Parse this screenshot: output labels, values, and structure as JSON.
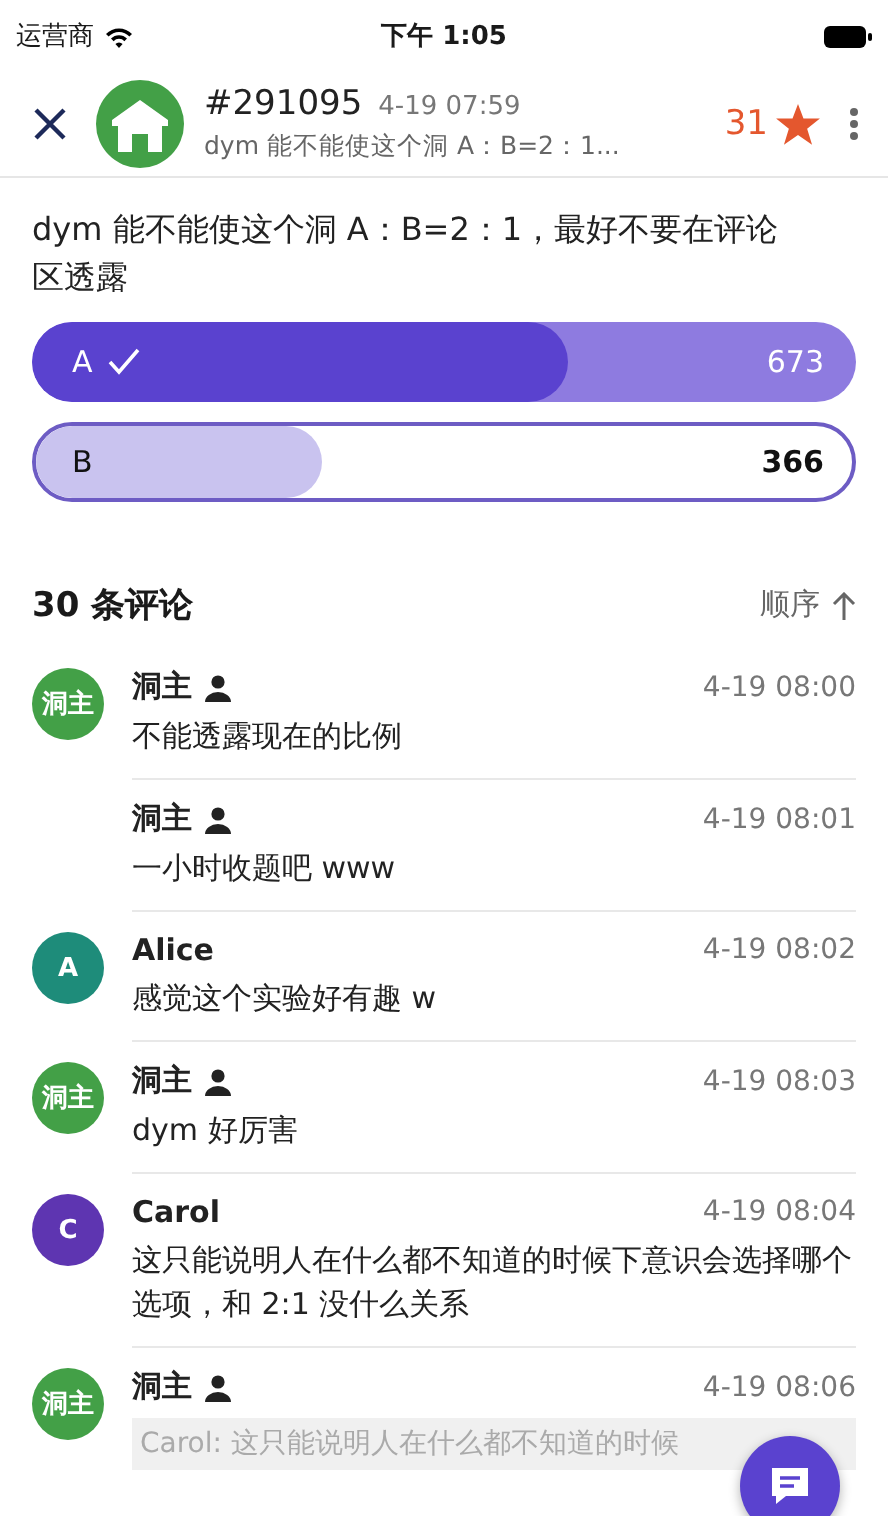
{
  "status_bar": {
    "carrier": "运营商",
    "time": "下午 1:05"
  },
  "header": {
    "title": "#291095",
    "time": "4-19 07:59",
    "subtitle": "dym 能不能使这个洞 A：B=2：1...",
    "stars": "31"
  },
  "post": {
    "text": "dym 能不能使这个洞 A：B=2：1，最好不要在评论区透露"
  },
  "poll": [
    {
      "label": "A",
      "count": "673",
      "level": 0.65,
      "selected": true
    },
    {
      "label": "B",
      "count": "366",
      "level": 0.35,
      "selected": false
    }
  ],
  "comments_header": {
    "count": "30 条评论",
    "sort": "顺序"
  },
  "comments": [
    {
      "avatar": {
        "label": "洞主",
        "color": "#43a047"
      },
      "name": "洞主",
      "is_owner": true,
      "time": "4-19 08:00",
      "text": "不能透露现在的比例"
    },
    {
      "name": "洞主",
      "is_owner": true,
      "time": "4-19 08:01",
      "text": "一小时收题吧 www"
    },
    {
      "avatar": {
        "label": "A",
        "color": "#1e8c7a"
      },
      "name": "Alice",
      "is_owner": false,
      "time": "4-19 08:02",
      "text": "感觉这个实验好有趣 w"
    },
    {
      "avatar": {
        "label": "洞主",
        "color": "#43a047"
      },
      "name": "洞主",
      "is_owner": true,
      "time": "4-19 08:03",
      "text": "dym 好厉害"
    },
    {
      "avatar": {
        "label": "C",
        "color": "#5e35b1"
      },
      "name": "Carol",
      "is_owner": false,
      "time": "4-19 08:04",
      "text": "这只能说明人在什么都不知道的时候下意识会选择哪个选项，和 2:1 没什么关系"
    },
    {
      "avatar": {
        "label": "洞主",
        "color": "#43a047"
      },
      "name": "洞主",
      "is_owner": true,
      "time": "4-19 08:06",
      "quote": "Carol: 这只能说明人在什么都不知道的时候"
    }
  ]
}
